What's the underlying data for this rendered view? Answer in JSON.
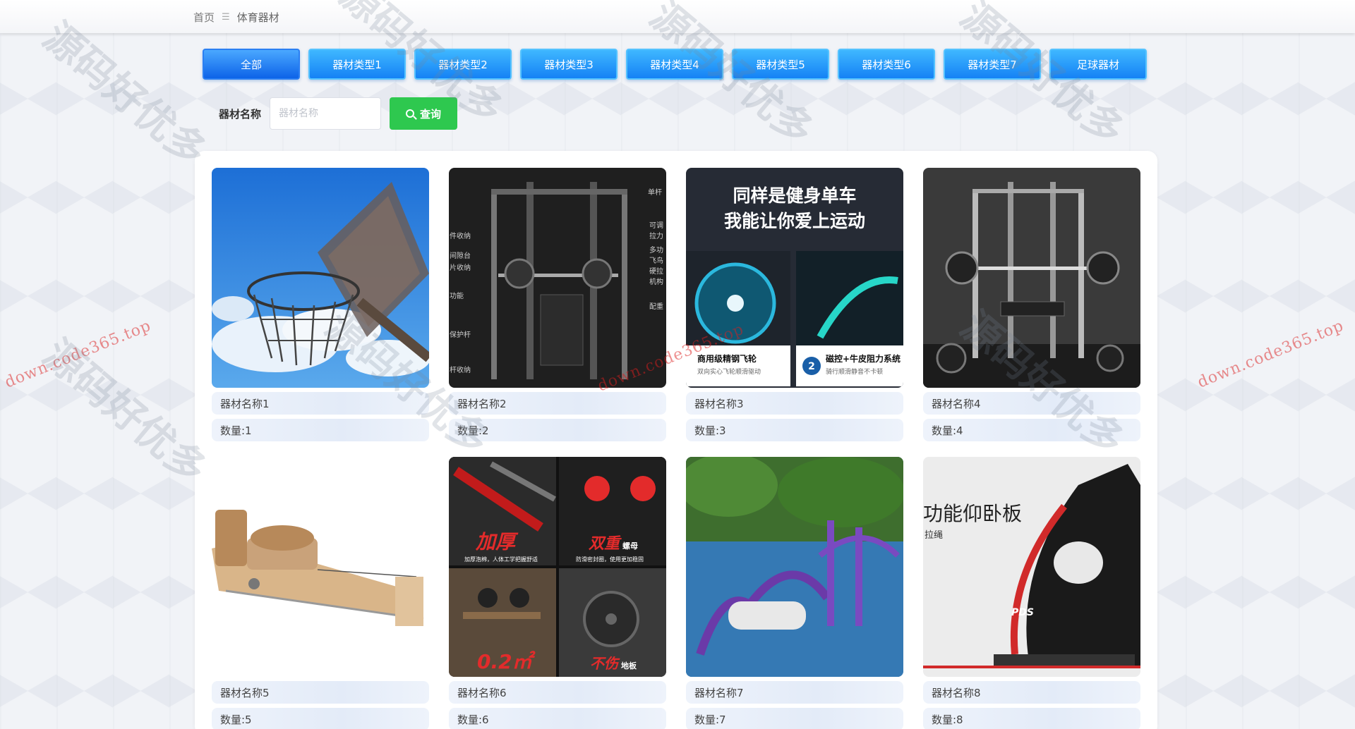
{
  "breadcrumb": {
    "home": "首页",
    "separator": "☰",
    "current": "体育器材"
  },
  "tabs": [
    {
      "label": "全部",
      "active": true
    },
    {
      "label": "器材类型1",
      "active": false
    },
    {
      "label": "器材类型2",
      "active": false
    },
    {
      "label": "器材类型3",
      "active": false
    },
    {
      "label": "器材类型4",
      "active": false
    },
    {
      "label": "器材类型5",
      "active": false
    },
    {
      "label": "器材类型6",
      "active": false
    },
    {
      "label": "器材类型7",
      "active": false
    },
    {
      "label": "足球器材",
      "active": false
    }
  ],
  "search": {
    "label": "器材名称",
    "placeholder": "器材名称",
    "value": "",
    "button": "查询"
  },
  "items": [
    {
      "name": "器材名称1",
      "qty": "数量:1",
      "image": "basketball-hoop"
    },
    {
      "name": "器材名称2",
      "qty": "数量:2",
      "image": "smith-machine",
      "image_text": [
        "单杆",
        "件收纳",
        "间隙台",
        "片收纳",
        "功能",
        "保护杆",
        "杆收纳",
        "可调",
        "拉力",
        "多功",
        "飞鸟",
        "硬拉",
        "机构",
        "配重"
      ]
    },
    {
      "name": "器材名称3",
      "qty": "数量:3",
      "image": "spin-bike-ad",
      "image_text": [
        "同样是健身单车",
        "我能让你爱上运动",
        "商用级精钢飞轮",
        "双向实心飞轮顺滑驱动",
        "磁控+牛皮阻力系统",
        "骑行顺滑静音不卡顿",
        "2"
      ]
    },
    {
      "name": "器材名称4",
      "qty": "数量:4",
      "image": "gym-rack"
    },
    {
      "name": "器材名称5",
      "qty": "数量:5",
      "image": "pilates-reformer"
    },
    {
      "name": "器材名称6",
      "qty": "数量:6",
      "image": "dumbbell-collage",
      "image_text": [
        "加厚",
        "加厚泡棉，人体工学把握舒适",
        "双重",
        "螺母",
        "防滑密封圈，使用更加稳固",
        "0.2㎡",
        "不伤",
        "地板"
      ]
    },
    {
      "name": "器材名称7",
      "qty": "数量:7",
      "image": "outdoor-fitness"
    },
    {
      "name": "器材名称8",
      "qty": "数量:8",
      "image": "situp-bench",
      "image_text": [
        "功能仰卧板",
        "拉绳",
        "PDS"
      ]
    }
  ],
  "watermark": {
    "url": "down.code365.top",
    "brand": "源码好优多"
  },
  "colors": {
    "tab_from": "#3fb7ff",
    "tab_to": "#1582f5",
    "search_button": "#2ec84f"
  }
}
